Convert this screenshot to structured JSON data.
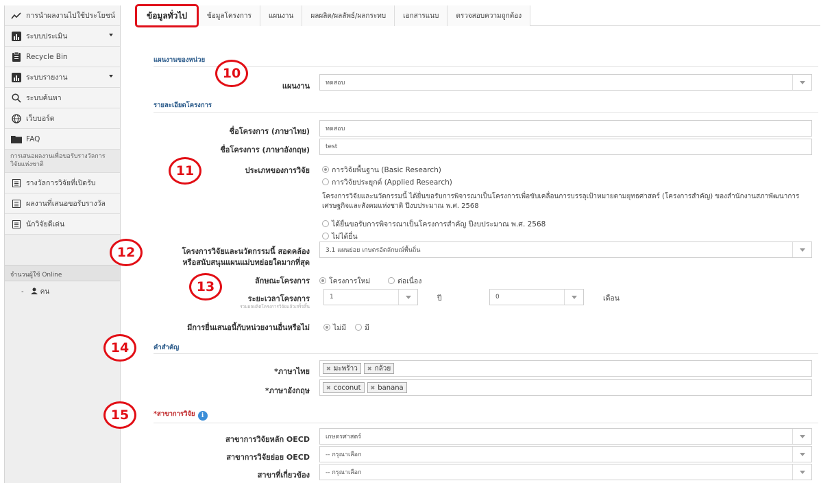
{
  "sidebar": {
    "items": [
      {
        "label": "การนำผลงานไปใช้ประโยชน์",
        "icon": "trend-line-icon",
        "caret": false
      },
      {
        "label": "ระบบประเมิน",
        "icon": "bar-chart-icon",
        "caret": true
      },
      {
        "label": "Recycle Bin",
        "icon": "clipboard-icon",
        "caret": false
      },
      {
        "label": "ระบบรายงาน",
        "icon": "bar-chart-icon",
        "caret": true
      },
      {
        "label": "ระบบค้นหา",
        "icon": "search-icon",
        "caret": false
      },
      {
        "label": "เว็บบอร์ด",
        "icon": "globe-icon",
        "caret": false
      },
      {
        "label": "FAQ",
        "icon": "folder-icon",
        "caret": false
      }
    ],
    "group_heading": "การเสนอผลงานเพื่อขอรับรางวัลการวิจัยแห่งชาติ",
    "group_items": [
      {
        "label": "รางวัลการวิจัยที่เปิดรับ",
        "icon": "list-icon"
      },
      {
        "label": "ผลงานที่เสนอขอรับรางวัล",
        "icon": "list-icon"
      },
      {
        "label": "นักวิจัยดีเด่น",
        "icon": "list-icon"
      }
    ],
    "online_heading": "จำนวนผู้ใช้ Online",
    "online_value": "-",
    "online_unit": "คน"
  },
  "tabs": [
    {
      "label": "ข้อมูลทั่วไป",
      "active": true
    },
    {
      "label": "ข้อมูลโครงการ",
      "active": false
    },
    {
      "label": "แผนงาน",
      "active": false
    },
    {
      "label": "ผลผลิต/ผลลัพธ์/ผลกระทบ",
      "active": false
    },
    {
      "label": "เอกสารแนบ",
      "active": false
    },
    {
      "label": "ตรวจสอบความถูกต้อง",
      "active": false
    }
  ],
  "form": {
    "section_plan": "แผนงานของหน่วย",
    "plan_label": "แผนงาน",
    "plan_value": "ทดสอบ",
    "section_detail": "รายละเอียดโครงการ",
    "name_th_label": "ชื่อโครงการ (ภาษาไทย)",
    "name_th_value": "ทดสอบ",
    "name_en_label": "ชื่อโครงการ (ภาษาอังกฤษ)",
    "name_en_value": "test",
    "research_type_label": "ประเภทของการวิจัย",
    "research_type_options": [
      "การวิจัยพื้นฐาน (Basic Research)",
      "การวิจัยประยุกต์ (Applied Research)"
    ],
    "strategic_text": "โครงการวิจัยและนวัตกรรมนี้ ได้ยื่นขอรับการพิจารณาเป็นโครงการเพื่อขับเคลื่อนการบรรลุเป้าหมายตามยุทธศาสตร์ (โครงการสำคัญ) ของสำนักงานสภาพัฒนาการเศรษฐกิจและสังคมแห่งชาติ ปีงบประมาณ พ.ศ. 2568",
    "strategic_options": [
      "ได้ยื่นขอรับการพิจารณาเป็นโครงการสำคัญ ปีงบประมาณ พ.ศ. 2568",
      "ไม่ได้ยื่น"
    ],
    "consistency_label_1": "โครงการวิจัยและนวัตกรรมนี้ สอดคล้อง",
    "consistency_label_2": "หรือสนับสนุนแผนแม่บทย่อยใดมากที่สุด",
    "consistency_value": "3.1 แผนย่อย เกษตรอัตลักษณ์พื้นถิ่น",
    "nature_label": "ลักษณะโครงการ",
    "nature_options": [
      "โครงการใหม่",
      "ต่อเนื่อง"
    ],
    "duration_label": "ระยะเวลาโครงการ",
    "duration_sublabel": "รวมผลผลิตโครงการวิจัยแล้วเสร็จสิ้น",
    "duration_years": "1",
    "duration_years_unit": "ปี",
    "duration_months": "0",
    "duration_months_unit": "เดือน",
    "submit_other_label": "มีการยื่นเสนอนี้กับหน่วยงานอื่นหรือไม่",
    "submit_other_options": [
      "ไม่มี",
      "มี"
    ],
    "section_keywords": "คำสำคัญ",
    "kw_th_label": "*ภาษาไทย",
    "kw_th_tags": [
      "มะพร้าว",
      "กล้วย"
    ],
    "kw_en_label": "*ภาษาอังกฤษ",
    "kw_en_tags": [
      "coconut",
      "banana"
    ],
    "section_field": "*สาขาการวิจัย",
    "oecd_main_label": "สาขาการวิจัยหลัก OECD",
    "oecd_main_value": "เกษตรศาสตร์",
    "oecd_sub_label": "สาขาการวิจัยย่อย OECD",
    "oecd_sub_value": "-- กรุณาเลือก",
    "related_label": "สาขาที่เกี่ยวข้อง",
    "related_value": "-- กรุณาเลือก"
  },
  "badges": [
    "10",
    "11",
    "12",
    "13",
    "14",
    "15"
  ],
  "colors": {
    "accent": "#e20e15",
    "section": "#2a5a8a",
    "info": "#3b8ed8"
  }
}
